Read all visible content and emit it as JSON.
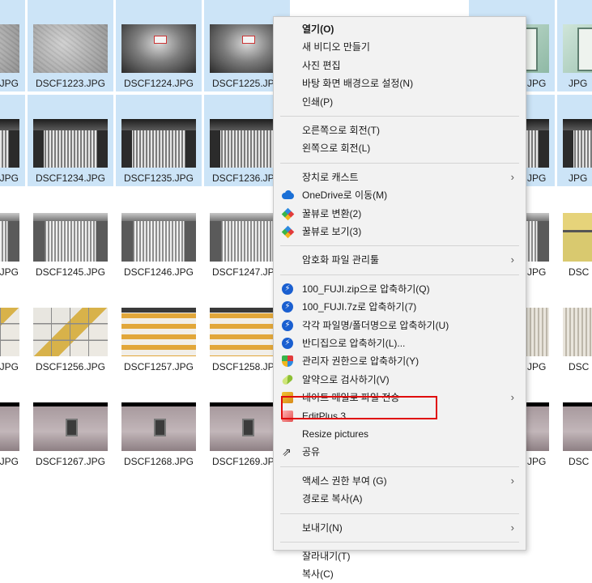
{
  "explorer": {
    "rows": [
      {
        "selected": true,
        "thumb": "t-concrete",
        "files": [
          "JPG",
          "DSCF1223.JPG",
          "DSCF1224.JPG",
          "DSCF1225.JPG",
          "",
          "",
          "3.JPG",
          "JPG"
        ],
        "thumbs": [
          "t-concrete",
          "t-concrete",
          "t-sign",
          "t-sign",
          "",
          "",
          "t-frame",
          "t-frame"
        ]
      },
      {
        "selected": true,
        "files": [
          "JPG",
          "DSCF1234.JPG",
          "DSCF1235.JPG",
          "DSCF1236.JPG",
          "",
          "",
          "9.JPG",
          "JPG"
        ],
        "thumbs": [
          "t-esc-dark",
          "t-esc-dark",
          "t-esc-dark",
          "t-esc-dark",
          "",
          "",
          "t-esc-dark",
          "t-esc-dark"
        ]
      },
      {
        "selected": false,
        "files": [
          "JPG",
          "DSCF1245.JPG",
          "DSCF1246.JPG",
          "DSCF1247.JPG",
          "",
          "",
          "0.JPG",
          "DSC"
        ],
        "thumbs": [
          "t-esc-light",
          "t-esc-light",
          "t-esc-light",
          "t-esc-light",
          "",
          "",
          "t-esc-light",
          "t-yellow"
        ]
      },
      {
        "selected": false,
        "files": [
          "JPG",
          "DSCF1256.JPG",
          "DSCF1257.JPG",
          "DSCF1258.JPG",
          "",
          "",
          "1.JPG",
          "DSC"
        ],
        "thumbs": [
          "t-tiles",
          "t-tiles",
          "t-stripes",
          "t-stripes",
          "",
          "",
          "t-blinds",
          "t-blinds"
        ]
      },
      {
        "selected": false,
        "files": [
          "JPG",
          "DSCF1267.JPG",
          "DSCF1268.JPG",
          "DSCF1269.JPG",
          "",
          "",
          "2.JPG",
          "DSC"
        ],
        "thumbs": [
          "t-panel",
          "t-panel",
          "t-panel",
          "t-panel",
          "",
          "",
          "t-panel",
          "t-panel"
        ]
      }
    ]
  },
  "context_menu": {
    "items": [
      {
        "type": "item",
        "label": "열기(O)",
        "bold": true,
        "icon": ""
      },
      {
        "type": "item",
        "label": "새 비디오 만들기",
        "icon": ""
      },
      {
        "type": "item",
        "label": "사진 편집",
        "icon": ""
      },
      {
        "type": "item",
        "label": "바탕 화면 배경으로 설정(N)",
        "icon": ""
      },
      {
        "type": "item",
        "label": "인쇄(P)",
        "icon": ""
      },
      {
        "type": "sep"
      },
      {
        "type": "item",
        "label": "오른쪽으로 회전(T)",
        "icon": ""
      },
      {
        "type": "item",
        "label": "왼쪽으로 회전(L)",
        "icon": ""
      },
      {
        "type": "sep"
      },
      {
        "type": "item",
        "label": "장치로 캐스트",
        "icon": "",
        "submenu": true
      },
      {
        "type": "item",
        "label": "OneDrive로 이동(M)",
        "icon": "onedrive-icon"
      },
      {
        "type": "item",
        "label": "꿀뷰로 변환(2)",
        "icon": "honeyview-icon"
      },
      {
        "type": "item",
        "label": "꿀뷰로 보기(3)",
        "icon": "honeyview-icon"
      },
      {
        "type": "sep"
      },
      {
        "type": "item",
        "label": "암호화 파일 관리툴",
        "icon": "",
        "submenu": true
      },
      {
        "type": "sep"
      },
      {
        "type": "item",
        "label": "100_FUJI.zip으로 압축하기(Q)",
        "icon": "bandizip-icon"
      },
      {
        "type": "item",
        "label": "100_FUJI.7z로 압축하기(7)",
        "icon": "bandizip-icon"
      },
      {
        "type": "item",
        "label": "각각 파일명/폴더명으로 압축하기(U)",
        "icon": "bandizip-icon"
      },
      {
        "type": "item",
        "label": "반디집으로 압축하기(L)...",
        "icon": "bandizip-icon"
      },
      {
        "type": "item",
        "label": "관리자 권한으로 압축하기(Y)",
        "icon": "admin-shield-icon"
      },
      {
        "type": "item",
        "label": "알약으로 검사하기(V)",
        "icon": "alyac-icon"
      },
      {
        "type": "item",
        "label": "네이트 메일로 파일 전송",
        "icon": "nate-mail-icon",
        "submenu": true
      },
      {
        "type": "item",
        "label": "EditPlus 3",
        "icon": "editplus-icon"
      },
      {
        "type": "item",
        "label": "Resize pictures",
        "icon": "",
        "highlighted": true
      },
      {
        "type": "item",
        "label": "공유",
        "icon": "share-icon"
      },
      {
        "type": "sep"
      },
      {
        "type": "item",
        "label": "액세스 권한 부여 (G)",
        "icon": "",
        "submenu": true
      },
      {
        "type": "item",
        "label": "경로로 복사(A)",
        "icon": ""
      },
      {
        "type": "sep"
      },
      {
        "type": "item",
        "label": "보내기(N)",
        "icon": "",
        "submenu": true
      },
      {
        "type": "sep"
      },
      {
        "type": "item",
        "label": "잘라내기(T)",
        "icon": ""
      },
      {
        "type": "item",
        "label": "복사(C)",
        "icon": ""
      }
    ],
    "submenu_arrow": "›",
    "bandizip_glyph": "⚡",
    "share_glyph": "⇗",
    "highlight_color": "#e00d0d"
  }
}
